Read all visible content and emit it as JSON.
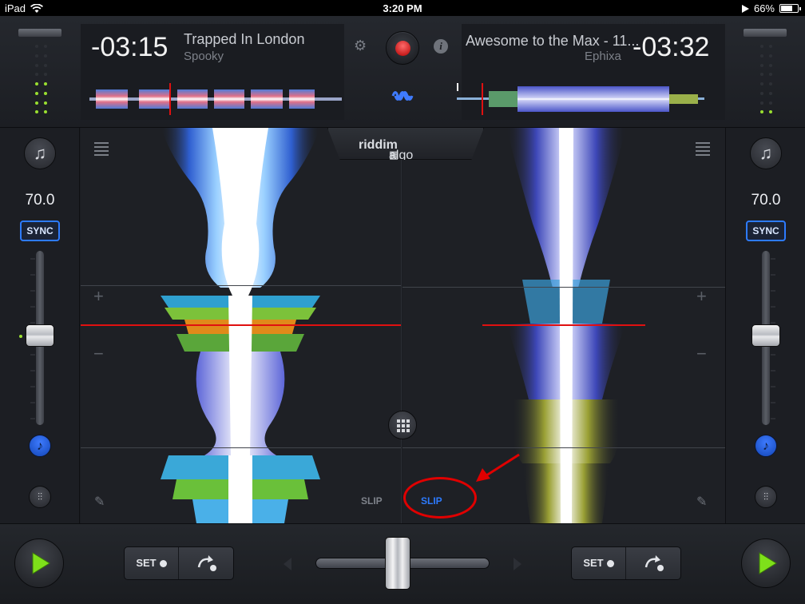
{
  "status_bar": {
    "device": "iPad",
    "time": "3:20 PM",
    "battery": "66%"
  },
  "deck_a": {
    "time_remaining": "-03:15",
    "title": "Trapped In London",
    "artist": "Spooky",
    "bpm": "70.0",
    "sync_label": "SYNC",
    "slip_label": "SLIP",
    "set_label": "SET"
  },
  "deck_b": {
    "time_remaining": "-03:32",
    "title": "Awesome to the Max - 11...",
    "artist": "Ephixa",
    "bpm": "70.0",
    "sync_label": "SYNC",
    "slip_label": "SLIP",
    "set_label": "SET"
  },
  "logo": {
    "part1": "algo",
    "part2": "riddim"
  },
  "markers": {
    "plus": "+",
    "minus": "−"
  },
  "colors": {
    "accent_blue": "#2d7bff",
    "record_red": "#c40000",
    "playhead_red": "#e01010",
    "play_green": "#7ee01a",
    "annotation_red": "#e00000"
  },
  "icons": {
    "add_music": "music-note-plus-icon",
    "settings": "gear-icon",
    "info": "info-icon",
    "waveform": "waveform-icon",
    "list": "list-icon",
    "pencil": "pencil-icon",
    "grid": "grid-icon",
    "play": "play-icon",
    "jump": "loop-arrow-icon",
    "eq": "mixer-sliders-icon",
    "note": "music-note-icon"
  }
}
